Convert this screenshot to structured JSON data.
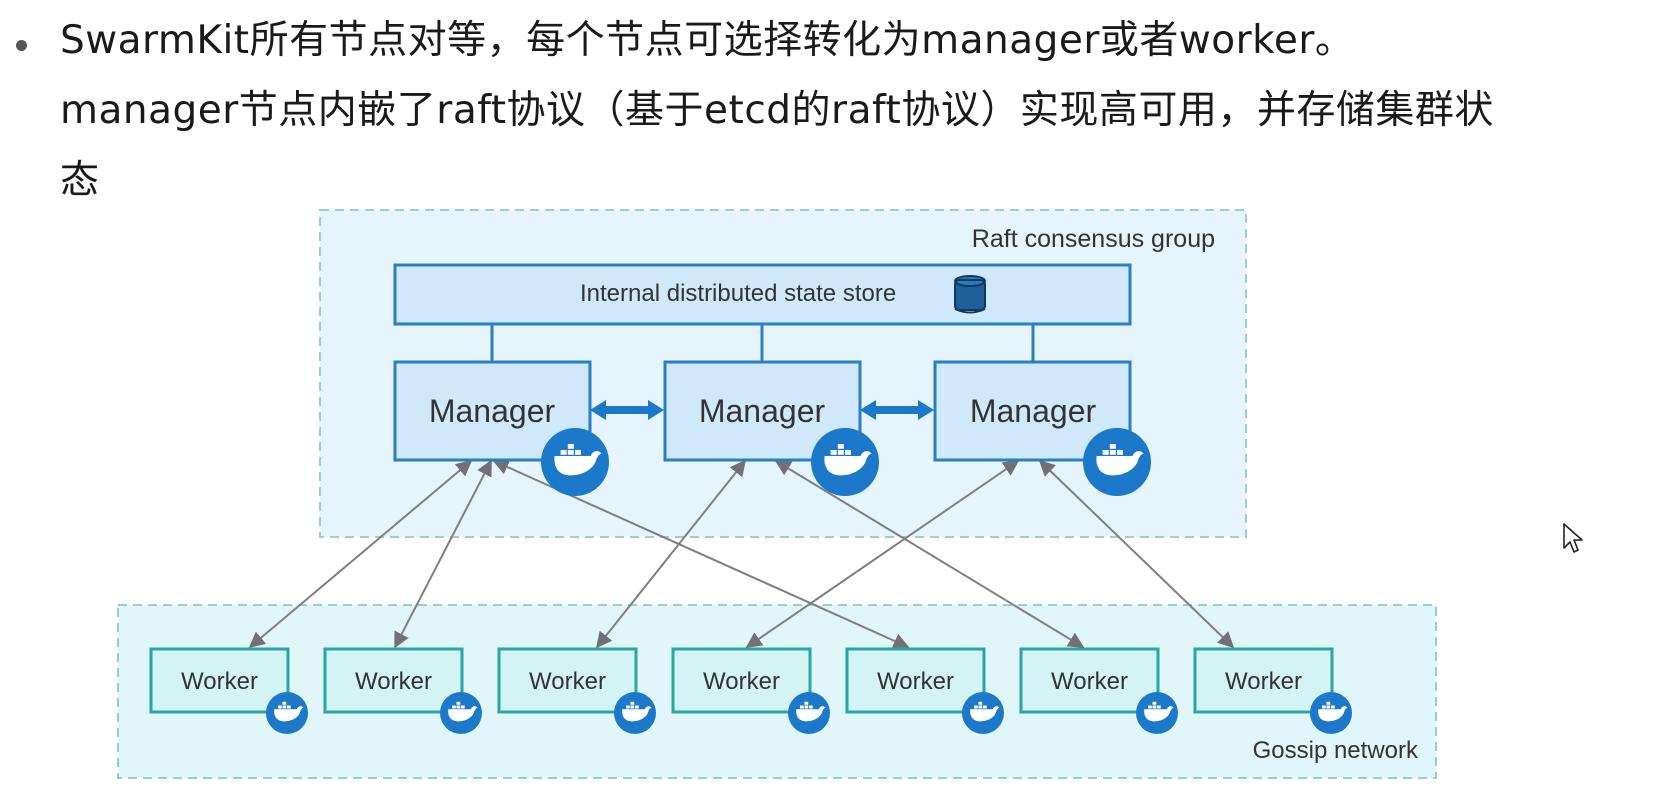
{
  "bullet": {
    "line1": "SwarmKit所有节点对等，每个节点可选择转化为manager或者worker。",
    "line2": "manager节点内嵌了raft协议（基于etcd的raft协议）实现高可用，并存储集群状",
    "line3": "态"
  },
  "diagram": {
    "raft_group_label": "Raft consensus group",
    "store_label": "Internal distributed state store",
    "manager_label": "Manager",
    "worker_label": "Worker",
    "gossip_label": "Gossip network"
  },
  "colors": {
    "box_border": "#2a7fc0",
    "box_fill": "#cfe9fb",
    "worker_border": "#2aa6a0",
    "worker_fill": "#d3f3f4",
    "docker_blue": "#1c78c9",
    "group_fill": "#e6f4fc",
    "gossip_fill": "#e0f6f8",
    "edge": "#7d7f85"
  },
  "managers": [
    "m1",
    "m2",
    "m3"
  ],
  "workers": [
    "w1",
    "w2",
    "w3",
    "w4",
    "w5",
    "w6",
    "w7"
  ]
}
